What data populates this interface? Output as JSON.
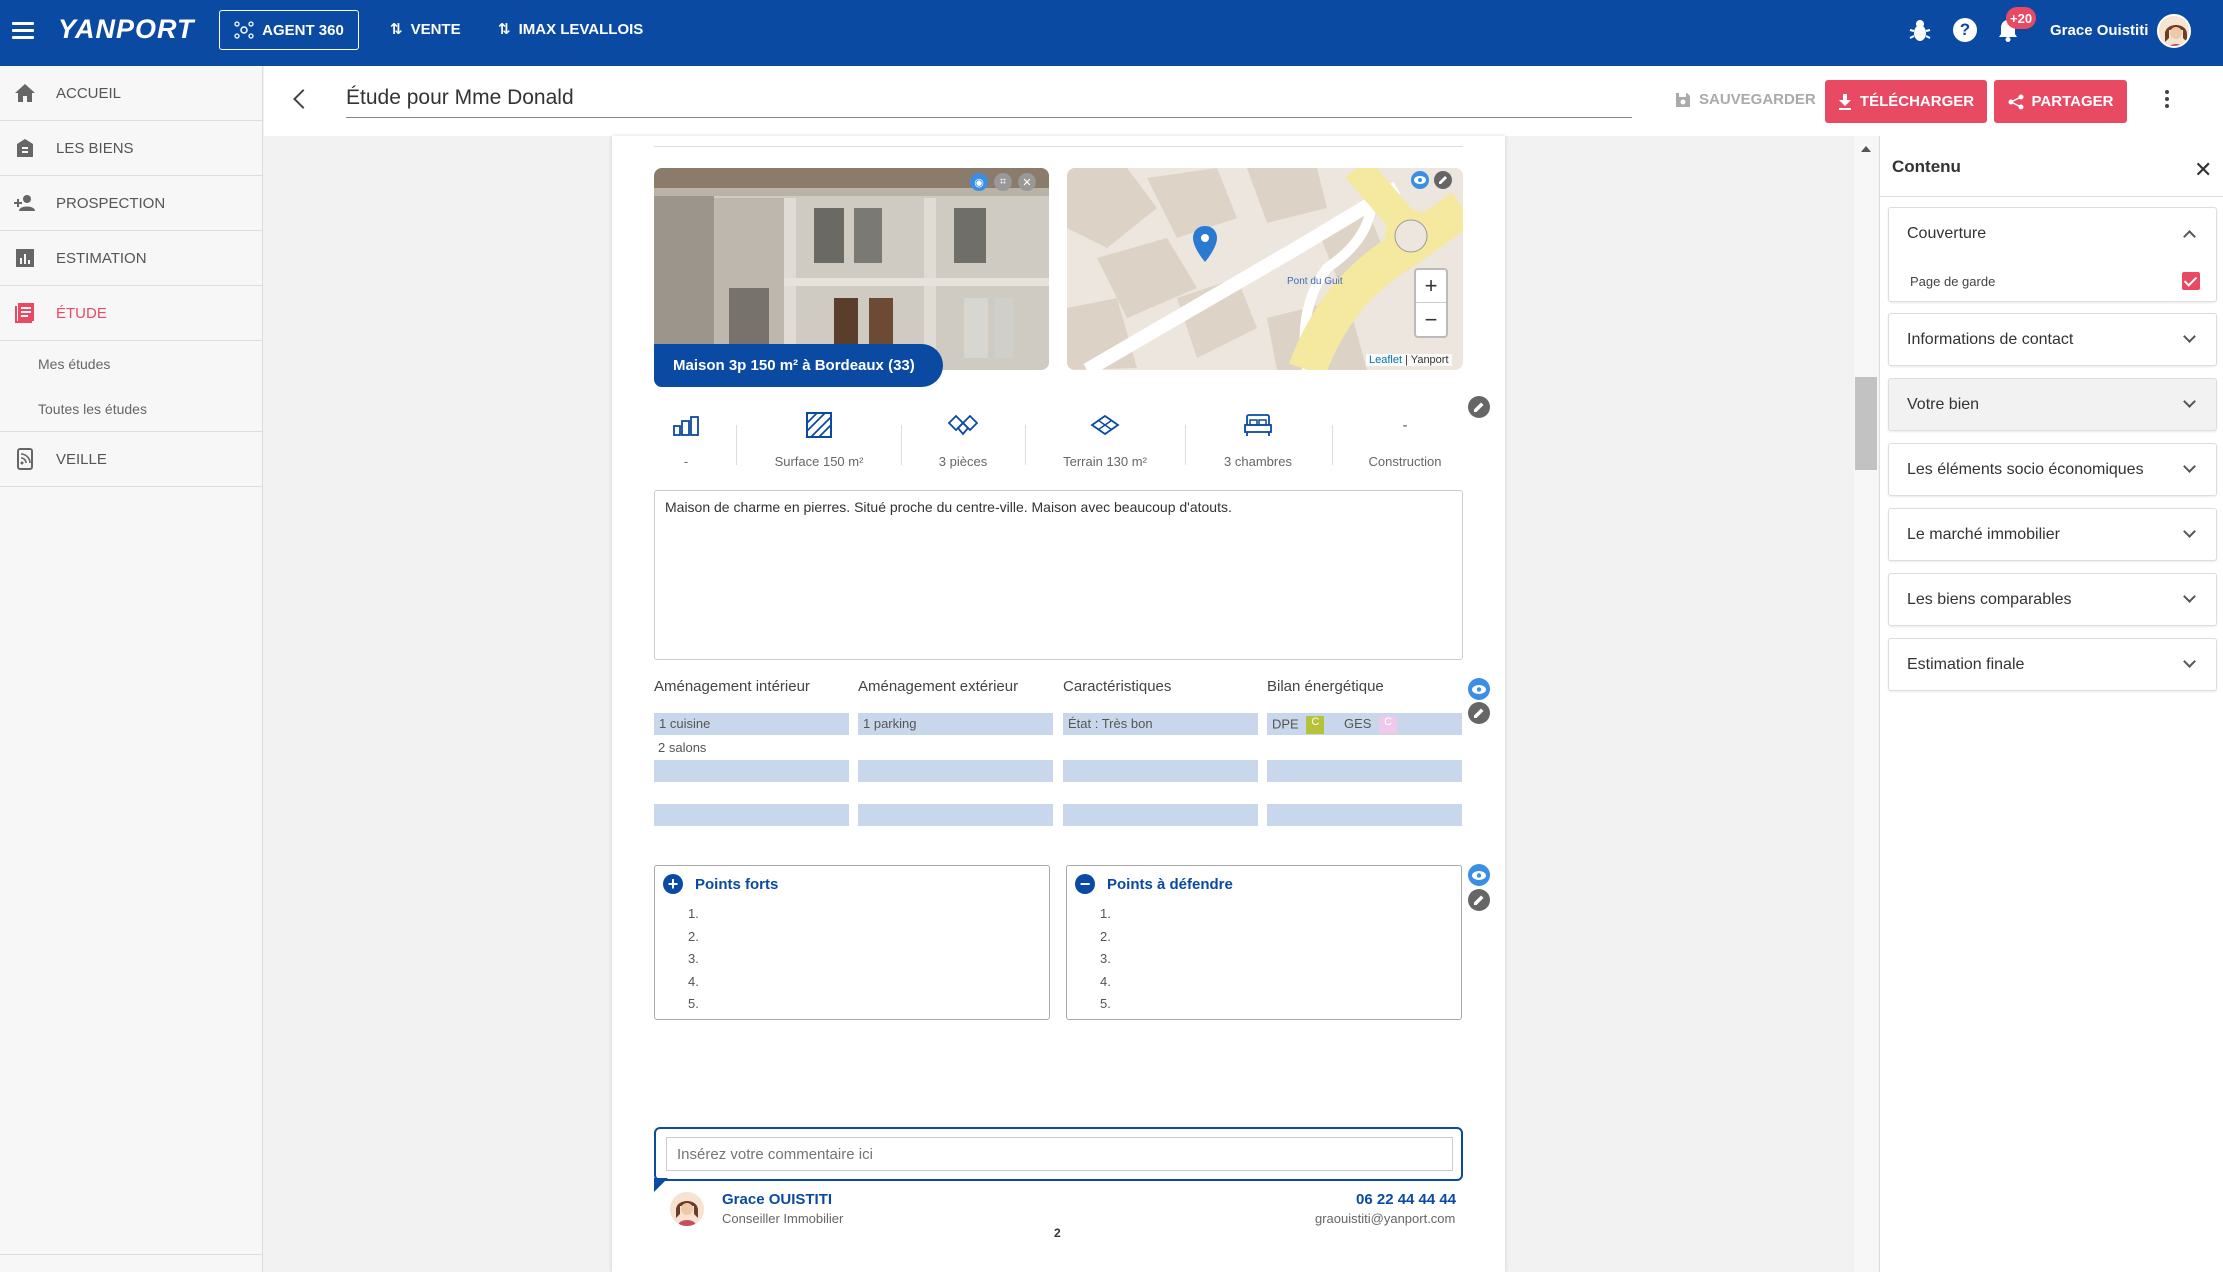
{
  "topbar": {
    "logo": "YANPORT",
    "agent_btn": "AGENT 360",
    "nav": [
      "VENTE",
      "IMAX LEVALLOIS"
    ],
    "notif_badge": "+20",
    "username": "Grace Ouistiti"
  },
  "sidebar": {
    "items": [
      {
        "label": "ACCUEIL",
        "icon": "home-icon"
      },
      {
        "label": "LES BIENS",
        "icon": "house-stack-icon"
      },
      {
        "label": "PROSPECTION",
        "icon": "person-add-icon"
      },
      {
        "label": "ESTIMATION",
        "icon": "bar-chart-icon"
      },
      {
        "label": "ÉTUDE",
        "icon": "document-list-icon"
      },
      {
        "label": "VEILLE",
        "icon": "rss-device-icon"
      }
    ],
    "sub_items": [
      "Mes études",
      "Toutes les études"
    ]
  },
  "header": {
    "title": "Étude pour Mme Donald",
    "save": "SAUVEGARDER",
    "download": "TÉLÉCHARGER",
    "share": "PARTAGER"
  },
  "property": {
    "tag": "Maison 3p 150 m² à Bordeaux (33)",
    "map_attribution_link": "Leaflet",
    "map_attribution_rest": " | Yanport",
    "map_label": "Pont du Guit",
    "features": [
      {
        "label": "-",
        "icon": "building-icon"
      },
      {
        "label": "Surface 150 m²",
        "icon": "surface-hatch-icon"
      },
      {
        "label": "3 pièces",
        "icon": "rooms-icon"
      },
      {
        "label": "Terrain 130 m²",
        "icon": "land-icon"
      },
      {
        "label": "3 chambres",
        "icon": "bed-icon"
      },
      {
        "value": "-",
        "label": "Construction"
      }
    ],
    "description": "Maison de charme en pierres. Situé proche du centre-ville. Maison avec beaucoup d'atouts."
  },
  "details": {
    "columns": [
      "Aménagement intérieur",
      "Aménagement extérieur",
      "Caractéristiques",
      "Bilan énergétique"
    ],
    "interior": [
      "1 cuisine",
      "2 salons"
    ],
    "exterior": [
      "1 parking"
    ],
    "characteristics": [
      "État : Très bon"
    ],
    "energy": {
      "dpe_label": "DPE",
      "dpe_value": "C",
      "dpe_color": "#b5c33a",
      "ges_label": "GES",
      "ges_value": "C",
      "ges_color": "#f0c9ea"
    }
  },
  "points": {
    "strengths_title": "Points forts",
    "weaknesses_title": "Points à défendre",
    "numbers": [
      "1.",
      "2.",
      "3.",
      "4.",
      "5."
    ]
  },
  "comment": {
    "placeholder": "Insérez votre commentaire ici"
  },
  "agent": {
    "name": "Grace OUISTITI",
    "role": "Conseiller Immobilier",
    "phone": "06 22 44 44 44",
    "email": "graouistiti@yanport.com"
  },
  "page_number": "2",
  "right_panel": {
    "title": "Contenu",
    "sections": [
      {
        "label": "Couverture",
        "expanded": true
      },
      {
        "label": "Informations de contact"
      },
      {
        "label": "Votre bien"
      },
      {
        "label": "Les éléments socio économiques"
      },
      {
        "label": "Le marché immobilier"
      },
      {
        "label": "Les biens comparables"
      },
      {
        "label": "Estimation finale"
      }
    ],
    "cover_sub": "Page de garde"
  },
  "colors": {
    "primary": "#0b4aa2",
    "accent": "#e84a64",
    "eye": "#3b8ee5"
  }
}
